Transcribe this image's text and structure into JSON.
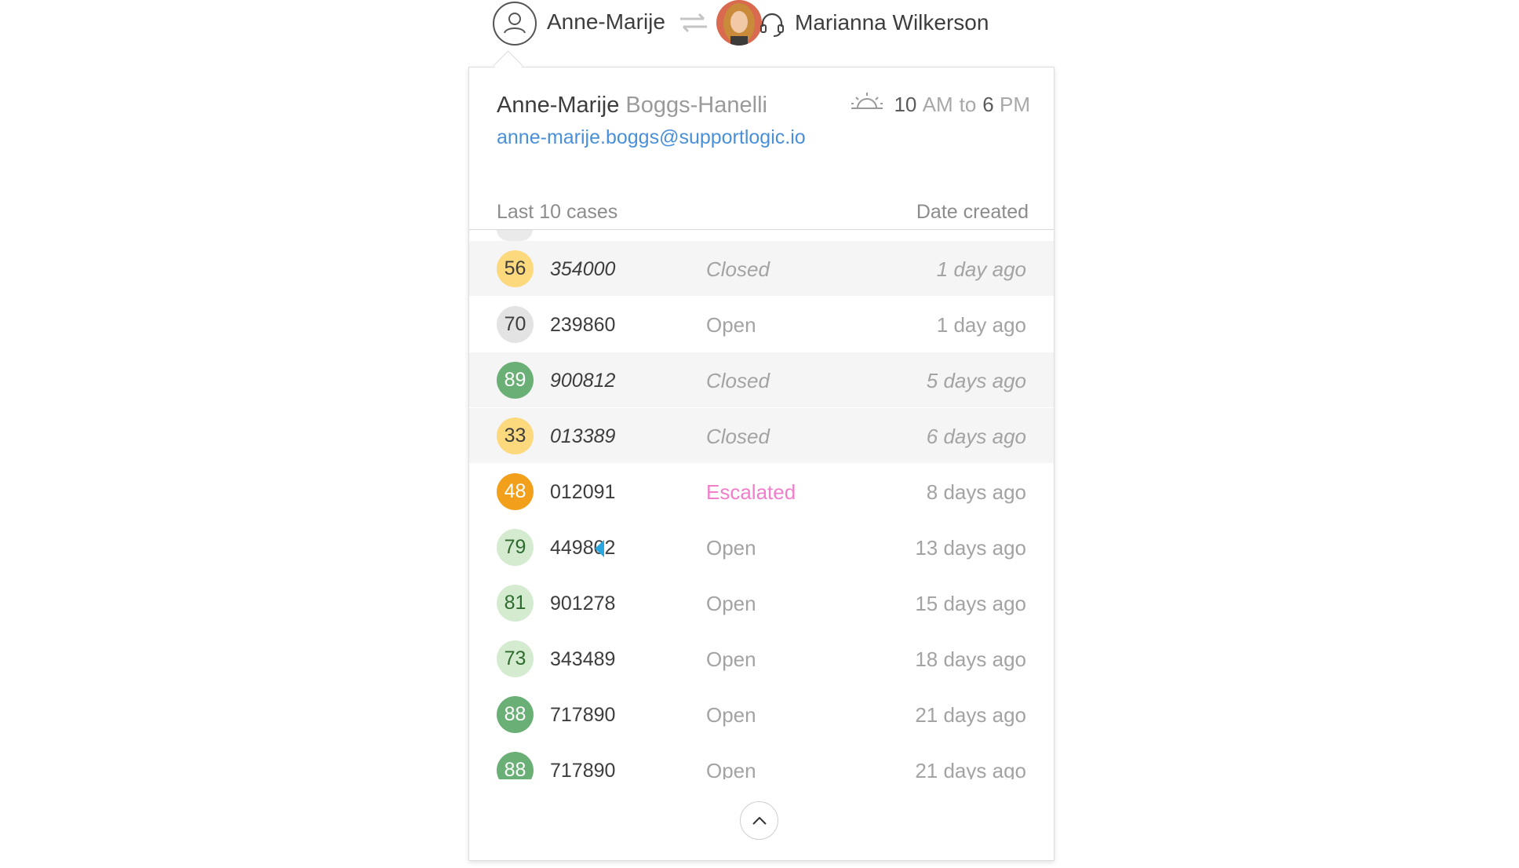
{
  "header": {
    "customer_first_name": "Anne-Marije",
    "agent_name": "Marianna Wilkerson",
    "icons": [
      "user-icon",
      "swap-icon",
      "headset-icon"
    ]
  },
  "profile": {
    "first_name": "Anne-Marije",
    "last_name": "Boggs-Hanelli",
    "email": "anne-marije.boggs@supportlogic.io",
    "hours": {
      "start_num": "10",
      "start_unit": "AM",
      "to": "to",
      "end_num": "6",
      "end_unit": "PM"
    }
  },
  "list": {
    "title": "Last 10 cases",
    "date_column": "Date created",
    "rows": [
      {
        "score": "56",
        "id": "354000",
        "status": "Closed",
        "date": "1 day ago",
        "badge_bg": "#fdd97e",
        "badge_fg": "#3d3d3d",
        "closed": true
      },
      {
        "score": "70",
        "id": "239860",
        "status": "Open",
        "date": "1 day ago",
        "badge_bg": "#e3e3e3",
        "badge_fg": "#3d3d3d",
        "closed": false
      },
      {
        "score": "89",
        "id": "900812",
        "status": "Closed",
        "date": "5 days ago",
        "badge_bg": "#6aaf76",
        "badge_fg": "#ffffff",
        "closed": true
      },
      {
        "score": "33",
        "id": "013389",
        "status": "Closed",
        "date": "6 days ago",
        "badge_bg": "#fdd97e",
        "badge_fg": "#3d3d3d",
        "closed": true
      },
      {
        "score": "48",
        "id": "012091",
        "status": "Escalated",
        "date": "8 days ago",
        "badge_bg": "#f2a01c",
        "badge_fg": "#ffffff",
        "closed": false
      },
      {
        "score": "79",
        "id": "449802",
        "status": "Open",
        "date": "13 days ago",
        "badge_bg": "#d4ebd0",
        "badge_fg": "#2f6b2f",
        "closed": false
      },
      {
        "score": "81",
        "id": "901278",
        "status": "Open",
        "date": "15 days ago",
        "badge_bg": "#d4ebd0",
        "badge_fg": "#2f6b2f",
        "closed": false
      },
      {
        "score": "73",
        "id": "343489",
        "status": "Open",
        "date": "18 days ago",
        "badge_bg": "#d4ebd0",
        "badge_fg": "#2f6b2f",
        "closed": false
      },
      {
        "score": "88",
        "id": "717890",
        "status": "Open",
        "date": "21 days ago",
        "badge_bg": "#6aaf76",
        "badge_fg": "#ffffff",
        "closed": false
      },
      {
        "score": "88",
        "id": "717890",
        "status": "Open",
        "date": "21 days ago",
        "badge_bg": "#6aaf76",
        "badge_fg": "#ffffff",
        "closed": false
      }
    ]
  },
  "colors": {
    "email_link": "#4a90d9",
    "escalated": "#f07ecb",
    "flag": "#2aa7e0"
  }
}
